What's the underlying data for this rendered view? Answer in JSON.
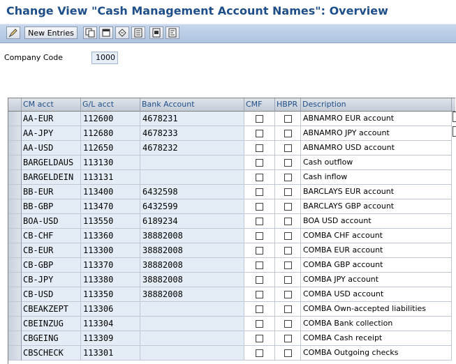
{
  "window": {
    "title": "Change View \"Cash Management Account Names\": Overview"
  },
  "toolbar": {
    "new_entries_label": "New Entries",
    "icons": [
      "edit-display-icon",
      "copy-icon",
      "delete-icon",
      "undo-icon",
      "select-all-icon",
      "select-block-icon",
      "deselect-all-icon"
    ]
  },
  "company_code": {
    "label": "Company Code",
    "value": "1000"
  },
  "table": {
    "columns": [
      "CM acct",
      "G/L acct",
      "Bank Account",
      "CMF",
      "HBPR",
      "Description"
    ],
    "rows": [
      {
        "cm": "AA-EUR",
        "gl": "112600",
        "bank": "4678231",
        "desc": "ABNAMRO EUR account"
      },
      {
        "cm": "AA-JPY",
        "gl": "112680",
        "bank": "4678233",
        "desc": "ABNAMRO JPY account"
      },
      {
        "cm": "AA-USD",
        "gl": "112650",
        "bank": "4678232",
        "desc": "ABNAMRO USD account"
      },
      {
        "cm": "BARGELDAUS",
        "gl": "113130",
        "bank": "",
        "desc": "Cash outflow"
      },
      {
        "cm": "BARGELDEIN",
        "gl": "113131",
        "bank": "",
        "desc": "Cash inflow"
      },
      {
        "cm": "BB-EUR",
        "gl": "113400",
        "bank": "6432598",
        "desc": "BARCLAYS EUR account"
      },
      {
        "cm": "BB-GBP",
        "gl": "113470",
        "bank": "6432599",
        "desc": "BARCLAYS GBP account"
      },
      {
        "cm": "BOA-USD",
        "gl": "113550",
        "bank": "6189234",
        "desc": "BOA USD account"
      },
      {
        "cm": "CB-CHF",
        "gl": "113360",
        "bank": "38882008",
        "desc": "COMBA CHF account"
      },
      {
        "cm": "CB-EUR",
        "gl": "113300",
        "bank": "38882008",
        "desc": "COMBA EUR account"
      },
      {
        "cm": "CB-GBP",
        "gl": "113370",
        "bank": "38882008",
        "desc": "COMBA GBP account"
      },
      {
        "cm": "CB-JPY",
        "gl": "113380",
        "bank": "38882008",
        "desc": "COMBA JPY account"
      },
      {
        "cm": "CB-USD",
        "gl": "113350",
        "bank": "38882008",
        "desc": "COMBA USD account"
      },
      {
        "cm": "CBEAKZEPT",
        "gl": "113306",
        "bank": "",
        "desc": "COMBA Own-accepted liabilities"
      },
      {
        "cm": "CBEINZUG",
        "gl": "113304",
        "bank": "",
        "desc": "COMBA Bank collection"
      },
      {
        "cm": "CBGEING",
        "gl": "113309",
        "bank": "",
        "desc": "COMBA Cash receipt"
      },
      {
        "cm": "CBSCHECK",
        "gl": "113301",
        "bank": "",
        "desc": "COMBA Outgoing checks"
      }
    ]
  }
}
